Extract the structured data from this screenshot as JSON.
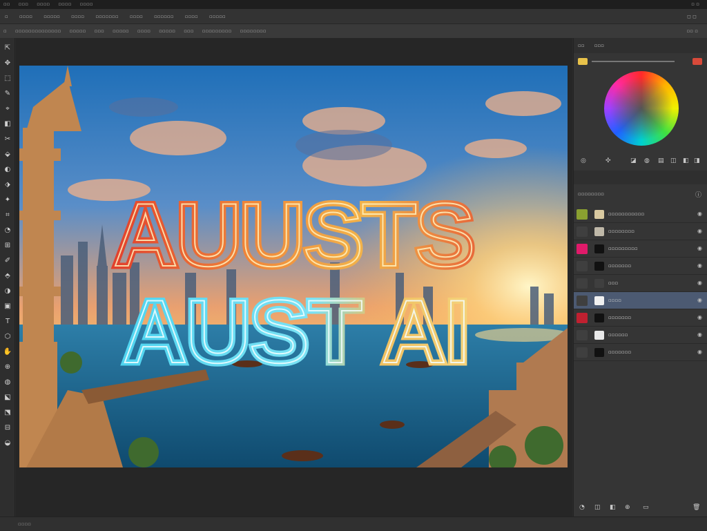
{
  "menubar": {
    "items": [
      "▫▫",
      "▫▫▫",
      "▫▫▫▫",
      "▫▫▫▫",
      "▫▫▫▫"
    ],
    "right": "▫ ▫"
  },
  "tabbar": {
    "tabs": [
      "▫",
      "▫▫▫▫",
      "▫▫▫▫▫",
      "▫▫▫▫",
      "▫▫▫▫▫▫▫",
      "▫▫▫▫",
      "▫▫▫▫▫▫",
      "▫▫▫▫",
      "▫▫▫▫▫"
    ],
    "right": "◻ ◻"
  },
  "optbar": {
    "items": [
      "▫",
      "▫▫▫▫▫▫▫▫▫▫▫▫▫▫",
      "▫▫▫▫▫",
      "▫▫▫",
      "▫▫▫▫▫",
      "▫▫▫▫",
      "▫▫▫▫▫",
      "▫▫▫",
      "▫▫▫▫▫▫▫▫▫",
      "▫▫▫▫▫▫▫▫"
    ],
    "right": "▫▫ ▫"
  },
  "tools": [
    "⇱",
    "✥",
    "⬚",
    "✎",
    "⌖",
    "◧",
    "✂",
    "⬙",
    "◐",
    "⬗",
    "✦",
    "⌗",
    "◔",
    "⊞",
    "✐",
    "⬘",
    "◑",
    "▣",
    "T",
    "⬡",
    "✋",
    "⊕",
    "◍",
    "⬕",
    "⬔",
    "⊟",
    "◒"
  ],
  "artwork": {
    "headline_top": "AUUSTS",
    "headline_bottom": "AUST AI"
  },
  "panel": {
    "tabs": [
      "▫▫",
      "▫▫▫"
    ],
    "colors": {
      "fg": "#e8c24a",
      "warning": "#d84a3a"
    },
    "color_icons": [
      "◎",
      "✣",
      "◪",
      "◍",
      "▤",
      "◫",
      "◧",
      "◨",
      "◰"
    ],
    "layers_header": "▫▫▫▫▫▫▫▫",
    "layers": [
      {
        "name": "▫▫▫▫▫▫▫▫▫▫▫",
        "vis": "#8aa030",
        "thumb": "#d9c9a0"
      },
      {
        "name": "▫▫▫▫▫▫▫▫",
        "vis": "#3f3f3f",
        "thumb": "#bfb8a8"
      },
      {
        "name": "▫▫▫▫▫▫▫▫▫",
        "vis": "#e01a6a",
        "thumb": "#111111"
      },
      {
        "name": "▫▫▫▫▫▫▫",
        "vis": "#3f3f3f",
        "thumb": "#111111"
      },
      {
        "name": "▫▫▫",
        "vis": "#3f3f3f",
        "thumb": "#3f3f3f"
      },
      {
        "name": "▫▫▫▫",
        "vis": "#3f3f3f",
        "thumb": "#f0f0f0"
      },
      {
        "name": "▫▫▫▫▫▫▫",
        "vis": "#c02030",
        "thumb": "#111111"
      },
      {
        "name": "▫▫▫▫▫▫",
        "vis": "#3f3f3f",
        "thumb": "#e8e8e8"
      },
      {
        "name": "▫▫▫▫▫▫▫",
        "vis": "#3f3f3f",
        "thumb": "#111111"
      }
    ],
    "bottom_icons": [
      "◔",
      "◫",
      "◧",
      "⊕",
      "▭",
      "🗑"
    ]
  },
  "statusbar": {
    "text": "▫▫▫▫"
  }
}
